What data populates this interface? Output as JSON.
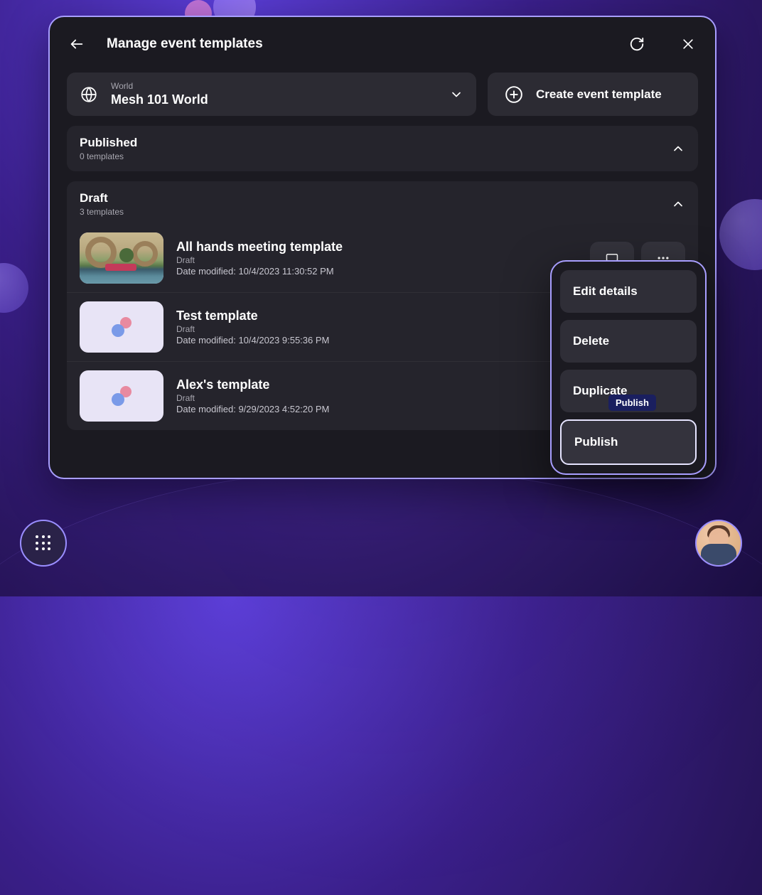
{
  "modal": {
    "title": "Manage event templates",
    "world_label": "World",
    "world_name": "Mesh 101 World",
    "create_label": "Create event template"
  },
  "sections": {
    "published": {
      "title": "Published",
      "subtitle": "0 templates"
    },
    "draft": {
      "title": "Draft",
      "subtitle": "3 templates"
    }
  },
  "templates": [
    {
      "name": "All hands meeting template",
      "status": "Draft",
      "date_prefix": "Date modified: ",
      "date": "10/4/2023 11:30:52 PM"
    },
    {
      "name": "Test template",
      "status": "Draft",
      "date_prefix": "Date modified: ",
      "date": "10/4/2023 9:55:36 PM"
    },
    {
      "name": "Alex's template",
      "status": "Draft",
      "date_prefix": "Date modified: ",
      "date": "9/29/2023 4:52:20 PM"
    }
  ],
  "context_menu": {
    "items": [
      {
        "label": "Edit details"
      },
      {
        "label": "Delete"
      },
      {
        "label": "Duplicate"
      },
      {
        "label": "Publish"
      }
    ]
  },
  "tooltip": "Publish"
}
